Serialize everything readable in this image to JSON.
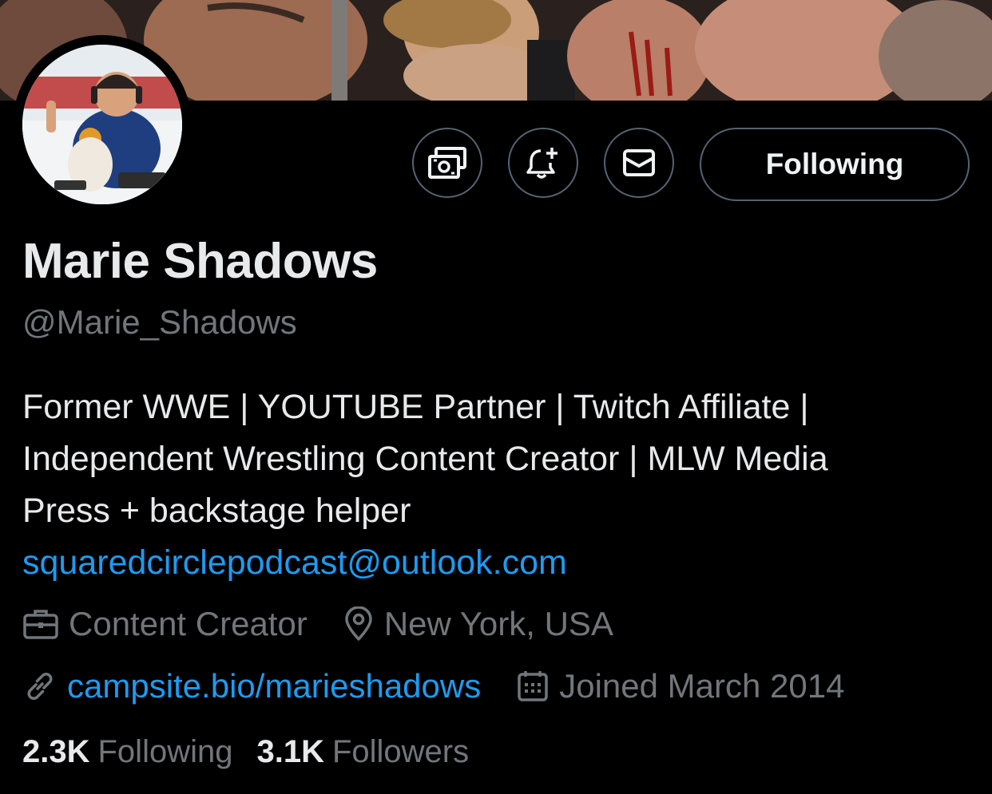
{
  "profile": {
    "name": "Marie Shadows",
    "handle": "@Marie_Shadows",
    "bio_lines": [
      "Former WWE | YOUTUBE Partner | Twitch Affiliate |",
      "Independent Wrestling Content Creator | MLW Media",
      "Press + backstage helper"
    ],
    "email": "squaredcirclepodcast@outlook.com",
    "category": "Content Creator",
    "location": "New York, USA",
    "website": "campsite.bio/marieshadows",
    "joined": "Joined March 2014"
  },
  "actions": {
    "follow_label": "Following",
    "icons": [
      "money-icon",
      "notification-bell-plus-icon",
      "message-envelope-icon"
    ]
  },
  "stats": {
    "following_count": "2.3K",
    "following_label": "Following",
    "followers_count": "3.1K",
    "followers_label": "Followers"
  },
  "colors": {
    "background": "#000000",
    "text": "#e7e9ea",
    "muted": "#71767b",
    "link": "#1d9bf0",
    "border": "#536471"
  }
}
